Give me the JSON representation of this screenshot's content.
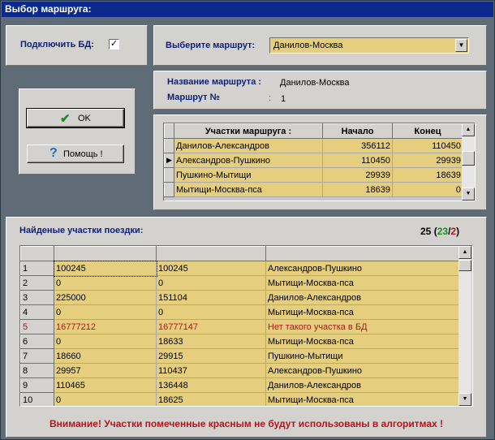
{
  "window": {
    "title": "Выбор маршруга:"
  },
  "db": {
    "label": "Подключить БД:",
    "checked": "✓"
  },
  "route_select": {
    "label": "Выберите маршрут:",
    "value": "Данилов-Москва"
  },
  "route_info": {
    "name_label": "Название маршрута :",
    "name_value": "Данилов-Москва",
    "num_label": "Маршрут №",
    "num_sep": ":",
    "num_value": "1"
  },
  "buttons": {
    "ok": "OK",
    "help": "Помощь !"
  },
  "segments": {
    "headers": [
      "Участки маршруга :",
      "Начало",
      "Конец"
    ],
    "rows": [
      [
        "Данилов-Александров",
        "356112",
        "110450"
      ],
      [
        "Александров-Пушкино",
        "110450",
        "29939"
      ],
      [
        "Пушкино-Мытищи",
        "29939",
        "18639"
      ],
      [
        "Мытищи-Москва-пса",
        "18639",
        "0"
      ]
    ]
  },
  "found": {
    "label": "Найденые участки поездки:",
    "count_total": "25",
    "count_ok": "23",
    "count_bad": "2",
    "rows": [
      {
        "n": "1",
        "a": "100245",
        "b": "100245",
        "name": "Александров-Пушкино",
        "red": false
      },
      {
        "n": "2",
        "a": "0",
        "b": "0",
        "name": "Мытищи-Москва-пса",
        "red": false
      },
      {
        "n": "3",
        "a": "225000",
        "b": "151104",
        "name": "Данилов-Александров",
        "red": false
      },
      {
        "n": "4",
        "a": "0",
        "b": "0",
        "name": "Мытищи-Москва-пса",
        "red": false
      },
      {
        "n": "5",
        "a": "16777212",
        "b": "16777147",
        "name": "Нет такого участка в БД",
        "red": true
      },
      {
        "n": "6",
        "a": "0",
        "b": "18633",
        "name": "Мытищи-Москва-пса",
        "red": false
      },
      {
        "n": "7",
        "a": "18660",
        "b": "29915",
        "name": "Пушкино-Мытищи",
        "red": false
      },
      {
        "n": "8",
        "a": "29957",
        "b": "110437",
        "name": "Александров-Пушкино",
        "red": false
      },
      {
        "n": "9",
        "a": "110465",
        "b": "136448",
        "name": "Данилов-Александров",
        "red": false
      },
      {
        "n": "10",
        "a": "0",
        "b": "18625",
        "name": "Мытищи-Москва-пса",
        "red": false
      }
    ]
  },
  "warning": "Внимание! Участки помеченные красным не будут использованы  в алгоритмах !",
  "colors": {
    "title": "#0c2a8e",
    "cell": "#e5cf7e",
    "red": "#b0161e",
    "green": "#1f8a1f"
  }
}
